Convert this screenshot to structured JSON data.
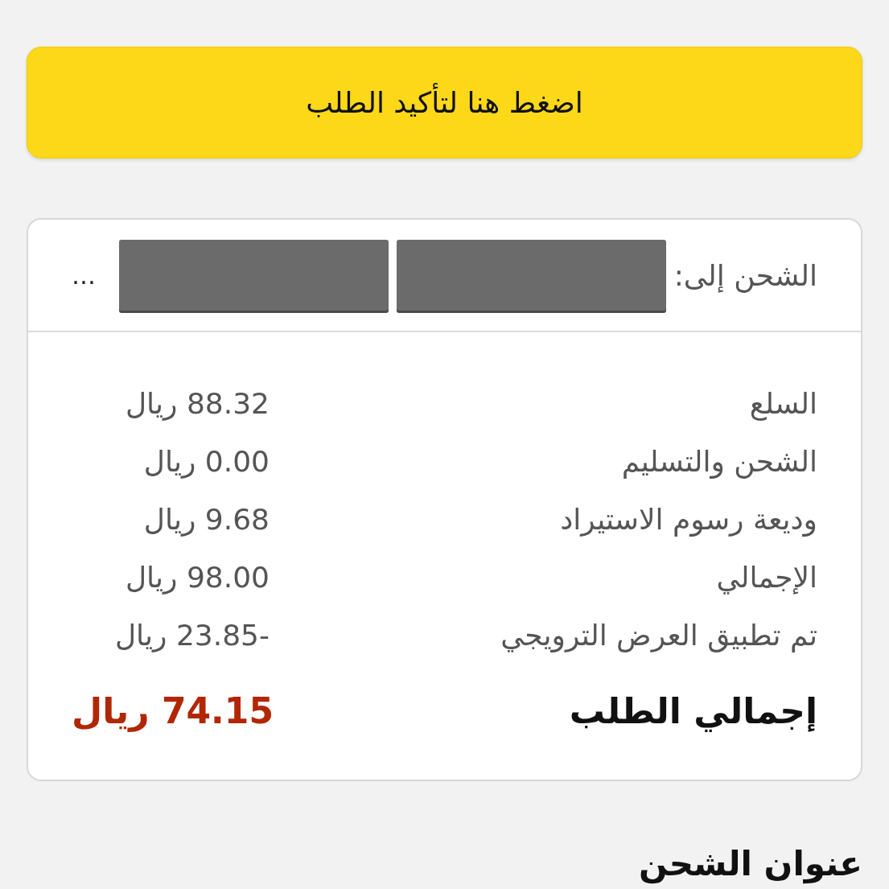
{
  "confirm_button": {
    "label": "اضغط هنا لتأكيد الطلب"
  },
  "shipping_to": {
    "label": "الشحن إلى:",
    "address": "…"
  },
  "summary": [
    {
      "label": "السلع",
      "value": "88.32 ريال"
    },
    {
      "label": "الشحن والتسليم",
      "value": "0.00 ريال"
    },
    {
      "label": "وديعة رسوم الاستيراد",
      "value": "9.68 ريال"
    },
    {
      "label": "الإجمالي",
      "value": "98.00 ريال"
    },
    {
      "label": "تم تطبيق العرض الترويجي",
      "value": "-23.85 ريال"
    }
  ],
  "order_total": {
    "label": "إجمالي الطلب",
    "value": "74.15 ريال"
  },
  "section_heading": "عنوان الشحن"
}
